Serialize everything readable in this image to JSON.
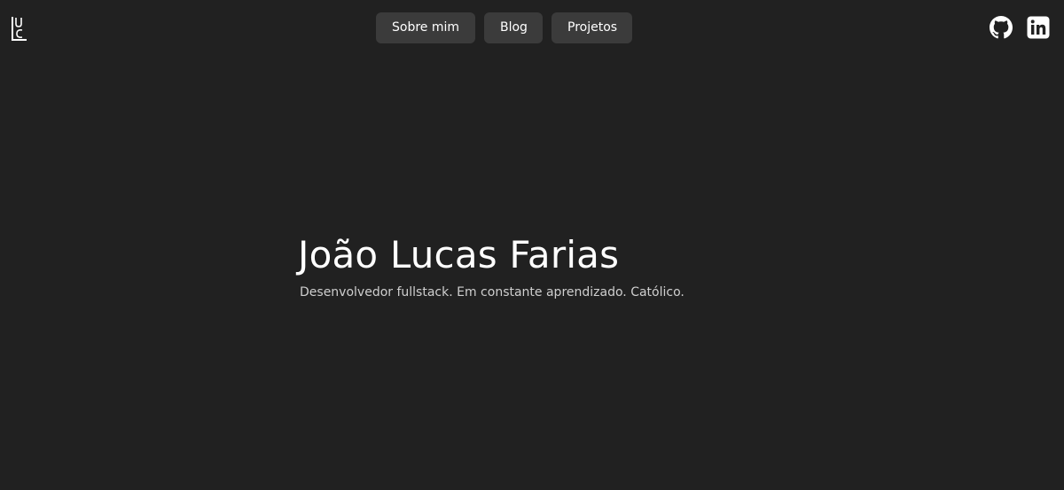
{
  "logo": {
    "icon": "ulc-monogram-icon"
  },
  "nav": {
    "items": [
      {
        "label": "Sobre mim"
      },
      {
        "label": "Blog"
      },
      {
        "label": "Projetos"
      }
    ]
  },
  "social": {
    "github_icon": "github-icon",
    "linkedin_icon": "linkedin-icon"
  },
  "hero": {
    "name": "João Lucas Farias",
    "tagline": "Desenvolvedor fullstack. Em constante aprendizado. Católico."
  },
  "colors": {
    "background": "#212121",
    "button": "#3b3b3b",
    "text": "#ffffff",
    "muted_text": "#cfcfcf"
  }
}
